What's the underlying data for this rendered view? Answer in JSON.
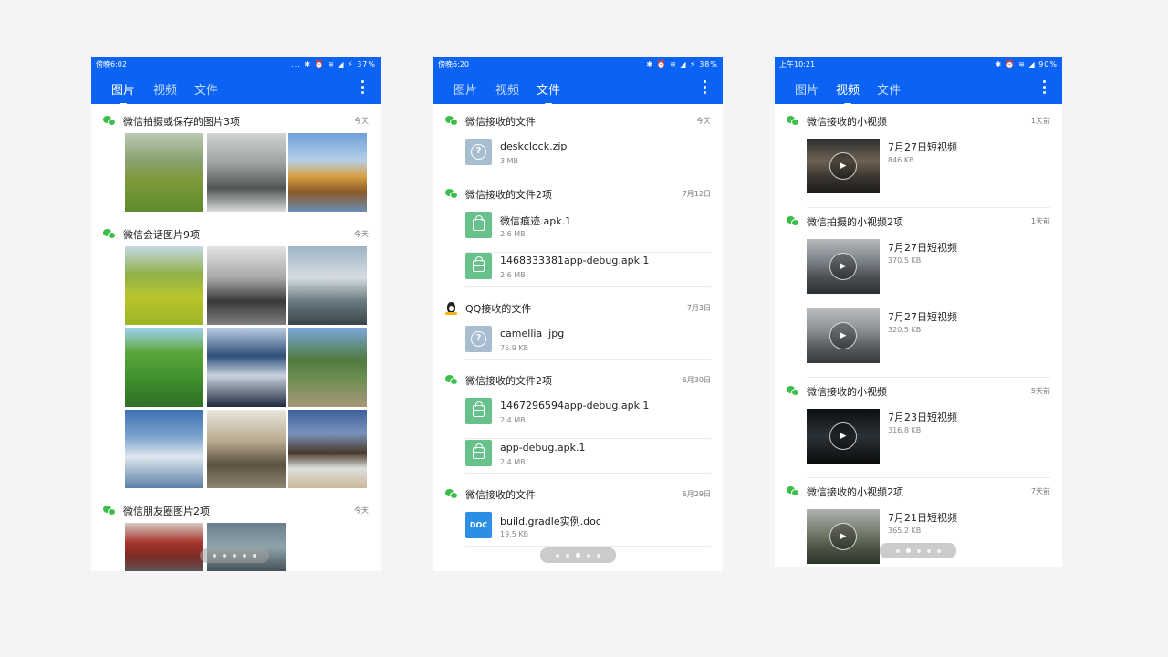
{
  "phone1": {
    "status": {
      "time": "傍晚6:02",
      "icons": "... ✱ ⏰ ≋ ◢ ⚡",
      "battery": "37%"
    },
    "tabs": [
      "图片",
      "视频",
      "文件"
    ],
    "active_tab": "图片",
    "sections": [
      {
        "title": "微信拍摄或保存的图片3项",
        "date": "今天",
        "icon": "wechat-icon",
        "image_count": 3
      },
      {
        "title": "微信会话图片9项",
        "date": "今天",
        "icon": "wechat-icon",
        "image_count": 9
      },
      {
        "title": "微信朋友圈图片2项",
        "date": "今天",
        "icon": "wechat-icon",
        "image_count": 2
      }
    ]
  },
  "phone2": {
    "status": {
      "time": "傍晚6:20",
      "icons": "✱ ⏰ ≋ ◢ ⚡",
      "battery": "38%"
    },
    "tabs": [
      "图片",
      "视频",
      "文件"
    ],
    "active_tab": "文件",
    "sections": [
      {
        "title": "微信接收的文件",
        "date": "今天",
        "icon": "wechat-icon",
        "files": [
          {
            "name": "deskclock.zip",
            "size": "3 MB",
            "type": "unknown"
          }
        ]
      },
      {
        "title": "微信接收的文件2项",
        "date": "7月12日",
        "icon": "wechat-icon",
        "files": [
          {
            "name": "微信痕迹.apk.1",
            "size": "2.6 MB",
            "type": "apk"
          },
          {
            "name": "1468333381app-debug.apk.1",
            "size": "2.6 MB",
            "type": "apk"
          }
        ]
      },
      {
        "title": "QQ接收的文件",
        "date": "7月3日",
        "icon": "qq-icon",
        "files": [
          {
            "name": "camellia .jpg",
            "size": "75.9 KB",
            "type": "unknown"
          }
        ]
      },
      {
        "title": "微信接收的文件2项",
        "date": "6月30日",
        "icon": "wechat-icon",
        "files": [
          {
            "name": "1467296594app-debug.apk.1",
            "size": "2.4 MB",
            "type": "apk"
          },
          {
            "name": "app-debug.apk.1",
            "size": "2.4 MB",
            "type": "apk"
          }
        ]
      },
      {
        "title": "微信接收的文件",
        "date": "6月29日",
        "icon": "wechat-icon",
        "files": [
          {
            "name": "build.gradle实例.doc",
            "size": "19.5 KB",
            "type": "doc",
            "badge": "DOC"
          }
        ]
      }
    ]
  },
  "phone3": {
    "status": {
      "time": "上午10:21",
      "icons": "✱ ⏰ ≋ ◢",
      "battery": "90%"
    },
    "tabs": [
      "图片",
      "视频",
      "文件"
    ],
    "active_tab": "视频",
    "sections": [
      {
        "title": "微信接收的小视频",
        "date": "1天前",
        "icon": "wechat-icon",
        "videos": [
          {
            "name": "7月27日短视频",
            "size": "846 KB"
          }
        ]
      },
      {
        "title": "微信拍摄的小视频2项",
        "date": "1天前",
        "icon": "wechat-icon",
        "videos": [
          {
            "name": "7月27日短视频",
            "size": "370.5 KB"
          },
          {
            "name": "7月27日短视频",
            "size": "320.5 KB"
          }
        ]
      },
      {
        "title": "微信接收的小视频",
        "date": "5天前",
        "icon": "wechat-icon",
        "videos": [
          {
            "name": "7月23日短视频",
            "size": "316.8 KB"
          }
        ]
      },
      {
        "title": "微信接收的小视频2项",
        "date": "7天前",
        "icon": "wechat-icon",
        "videos": [
          {
            "name": "7月21日短视频",
            "size": "365.2 KB"
          }
        ]
      }
    ]
  },
  "pager": {
    "pages": 5,
    "active_page": 3
  },
  "colors": {
    "appbar": "#0b63f6",
    "wechat": "#3cbe4b",
    "apk": "#67c18a",
    "unknown_file": "#a9bdd0",
    "doc": "#2b8fe4"
  }
}
